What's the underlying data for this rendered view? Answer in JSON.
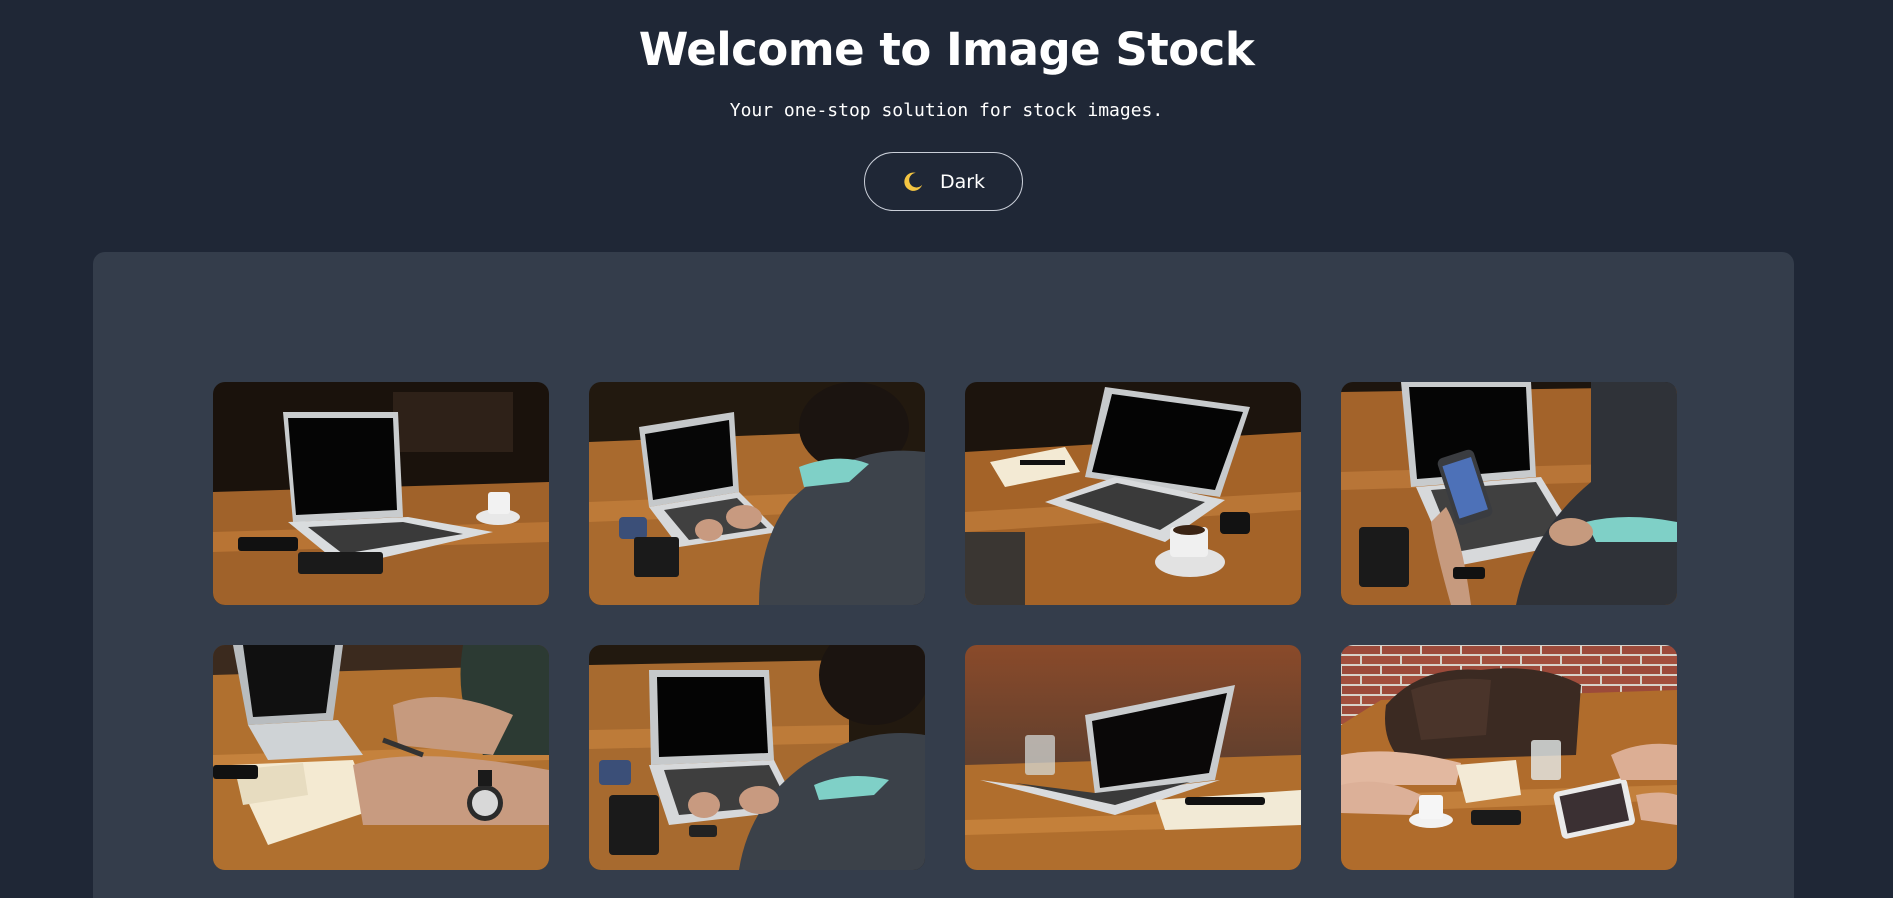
{
  "header": {
    "title": "Welcome to Image Stock",
    "subtitle": "Your one-stop solution for stock images."
  },
  "theme_toggle": {
    "label": "Dark",
    "icon": "moon-icon"
  },
  "gallery": {
    "items": [
      {
        "name": "gallery-image-1",
        "alt": "Laptop on wooden table with coffee cup and phones"
      },
      {
        "name": "gallery-image-2",
        "alt": "Person typing on laptop at outdoor table"
      },
      {
        "name": "gallery-image-3",
        "alt": "Open laptop with notebook, coffee and phone on table"
      },
      {
        "name": "gallery-image-4",
        "alt": "Person holding phone in front of laptop"
      },
      {
        "name": "gallery-image-5",
        "alt": "Hands writing in notebook next to laptop"
      },
      {
        "name": "gallery-image-6",
        "alt": "Person typing on laptop with phone and notebook"
      },
      {
        "name": "gallery-image-7",
        "alt": "Laptop with glass of water on wooden table"
      },
      {
        "name": "gallery-image-8",
        "alt": "Bag, tablet and coffee on table against brick wall"
      }
    ]
  },
  "colors": {
    "background": "#1f2736",
    "panel": "#343d4b",
    "wood": "#a86a2c",
    "moon": "#f4c542"
  }
}
